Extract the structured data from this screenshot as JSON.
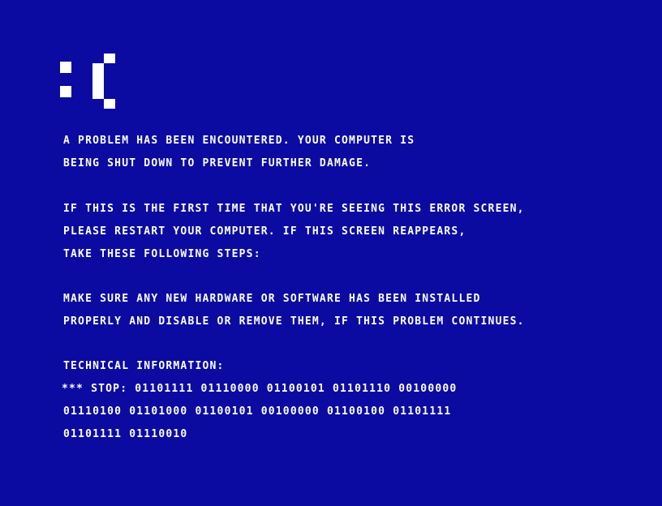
{
  "screen": {
    "background_color": "#0b0ba2",
    "text_color": "#ffffff",
    "icon": "sad-face-icon"
  },
  "message": {
    "paragraph_1": [
      "A PROBLEM HAS BEEN ENCOUNTERED. YOUR COMPUTER IS",
      "BEING SHUT DOWN TO PREVENT FURTHER DAMAGE."
    ],
    "paragraph_2": [
      "IF THIS IS THE FIRST TIME THAT YOU'RE SEEING THIS ERROR SCREEN,",
      "PLEASE RESTART YOUR COMPUTER. IF THIS SCREEN REAPPEARS,",
      "TAKE THESE FOLLOWING STEPS:"
    ],
    "paragraph_3": [
      "MAKE SURE ANY NEW HARDWARE OR SOFTWARE HAS BEEN INSTALLED",
      "PROPERLY AND DISABLE OR REMOVE THEM, IF THIS PROBLEM CONTINUES."
    ]
  },
  "technical": {
    "heading": "TECHNICAL INFORMATION:",
    "stop_line_1": "*** STOP: 01101111 01110000 01100101 01101110 00100000",
    "stop_line_2": "01110100 01101000 01100101 00100000 01100100 01101111",
    "stop_line_3": "01101111 01110010"
  }
}
